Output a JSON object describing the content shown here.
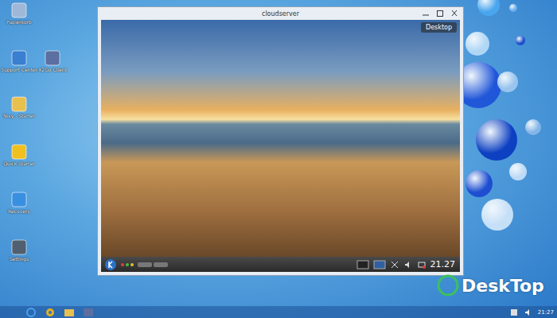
{
  "desktop_icons": [
    {
      "label": "Papierkorb"
    },
    {
      "label": "Support Center"
    },
    {
      "label": "X2Go Client"
    },
    {
      "label": "Nixy - Starter"
    },
    {
      "label": "Quick Starter"
    },
    {
      "label": "Recovery"
    },
    {
      "label": "Settings"
    }
  ],
  "window": {
    "title": "cloudserver"
  },
  "remote_desktop": {
    "widget_label": "Desktop",
    "clock": "21.27",
    "launcher_dots": [
      {
        "color": "#e04040"
      },
      {
        "color": "#40c040"
      },
      {
        "color": "#e0c030"
      }
    ]
  },
  "taskbar": {
    "clock": "21:27"
  },
  "watermark": {
    "text": "DeskTop"
  }
}
